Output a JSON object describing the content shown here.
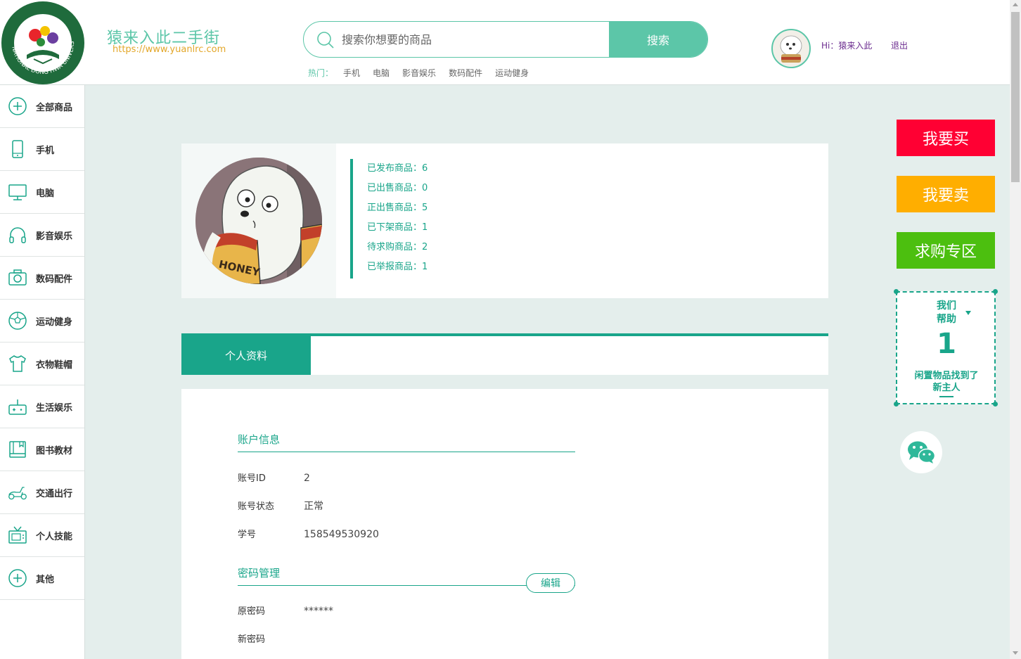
{
  "header": {
    "logo_text": "NATIONAL DONG HWA UNIVERSITY",
    "brand_title": "猿来入此二手街",
    "brand_url": "https://www.yuanlrc.com",
    "search_placeholder": "搜索你想要的商品",
    "search_button": "搜索",
    "hot_label": "热门：",
    "hot_items": [
      "手机",
      "电脑",
      "影音娱乐",
      "数码配件",
      "运动健身"
    ],
    "greeting": "Hi：猿来入此",
    "logout": "退出"
  },
  "sidebar": {
    "items": [
      {
        "label": "全部商品",
        "icon": "plus-circle-icon"
      },
      {
        "label": "手机",
        "icon": "phone-icon"
      },
      {
        "label": "电脑",
        "icon": "monitor-icon"
      },
      {
        "label": "影音娱乐",
        "icon": "headphones-icon"
      },
      {
        "label": "数码配件",
        "icon": "camera-icon"
      },
      {
        "label": "运动健身",
        "icon": "ball-icon"
      },
      {
        "label": "衣物鞋帽",
        "icon": "shirt-icon"
      },
      {
        "label": "生活娱乐",
        "icon": "gamepad-icon"
      },
      {
        "label": "图书教材",
        "icon": "book-icon"
      },
      {
        "label": "交通出行",
        "icon": "scooter-icon"
      },
      {
        "label": "个人技能",
        "icon": "tv-icon"
      },
      {
        "label": "其他",
        "icon": "plus-circle-icon"
      }
    ]
  },
  "profile": {
    "stats": [
      "已发布商品：6",
      "已出售商品：0",
      "正出售商品：5",
      "已下架商品：1",
      "待求购商品：2",
      "已举报商品：1"
    ]
  },
  "tabs": {
    "active": "个人资料"
  },
  "account": {
    "section_title": "账户信息",
    "id_label": "账号ID",
    "id_value": "2",
    "status_label": "账号状态",
    "status_value": "正常",
    "student_label": "学号",
    "student_value": "158549530920"
  },
  "password": {
    "section_title": "密码管理",
    "edit_button": "编辑",
    "old_label": "原密码",
    "old_value": "******",
    "new_label": "新密码"
  },
  "right": {
    "buy": "我要买",
    "sell": "我要卖",
    "want": "求购专区",
    "help_line1": "我们",
    "help_line2": "帮助",
    "help_count": "1",
    "help_line3": "闲置物品找到了",
    "help_line4": "新主人",
    "colors": {
      "buy": "#ff0033",
      "sell": "#ffae00",
      "want": "#4cbf0f"
    }
  }
}
